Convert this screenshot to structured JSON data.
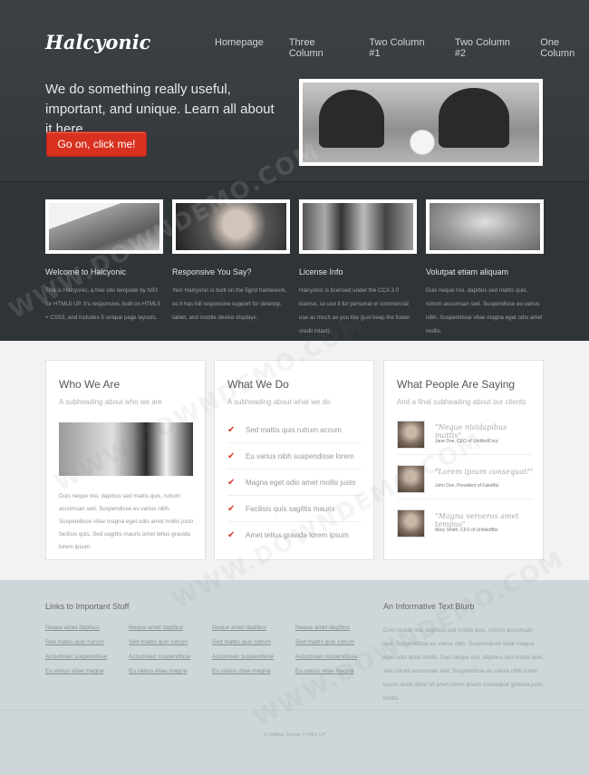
{
  "logo": "Halcyonic",
  "nav": [
    "Homepage",
    "Three Column",
    "Two Column #1",
    "Two Column #2",
    "One Column"
  ],
  "hero": {
    "text": "We do something really useful, important, and unique. Learn all about it here ...",
    "button": "Go on, click me!"
  },
  "features": [
    {
      "title": "Welcome to Halcyonic",
      "text": "This is Halcyonic, a free site template by N33 for HTML5 UP. It's responsive, built on HTML5 + CSS3, and includes 5 unique page layouts."
    },
    {
      "title": "Responsive You Say?",
      "text": "Yes! Halcyonic is built on the 5grid framework, so it has full responsive support for desktop, tablet, and mobile device displays."
    },
    {
      "title": "License Info",
      "text": "Halcyonic is licensed under the CCA 3.0 license, so use it for personal or commercial use as much as you like (just keep the footer credit intact)."
    },
    {
      "title": "Volutpat etiam aliquam",
      "text": "Duis neque nisi, dapibus sed mattis quis, rutrum accumsan sed. Suspendisse eu varius nibh. Suspendisse vitae magna eget odio amet mollis."
    }
  ],
  "who": {
    "title": "Who We Are",
    "subtitle": "A subheading about who we are",
    "text": "Duis neque nisi, dapibus sed mattis quis, rutrum accumsan sed. Suspendisse eu varius nibh. Suspendisse vitae magna eget odio amet mollis justo facilisis quis. Sed sagittis mauris amet tellus gravida lorem ipsum."
  },
  "what": {
    "title": "What We Do",
    "subtitle": "A subheading about what we do",
    "items": [
      "Sed mattis quis rutrum accum",
      "Eu varius nibh suspendisse lorem",
      "Magna eget odio amet mollis justo",
      "Facilisis quis sagittis mauris",
      "Amet tellus gravida lorem ipsum"
    ]
  },
  "testimonials": {
    "title": "What People Are Saying",
    "subtitle": "And a final subheading about our clients",
    "items": [
      {
        "quote": "\"Neque nisidapibus mattis\"",
        "name": "Jane Doe, CEO of UntitledCorp"
      },
      {
        "quote": "\"Lorem ipsum consequat!\"",
        "name": "John Doe, President of FakeBiz"
      },
      {
        "quote": "\"Magna veroeros amet tempus\"",
        "name": "Mary Smith, CFO of UntitledBiz"
      }
    ]
  },
  "footer": {
    "links_title": "Links to Important Stuff",
    "links": [
      [
        "Neque amet dapibus",
        "Neque amet dapibus",
        "Neque amet dapibus",
        "Neque amet dapibus"
      ],
      [
        "Sed mattis quis rutrum",
        "Sed mattis quis rutrum",
        "Sed mattis quis rutrum",
        "Sed mattis quis rutrum"
      ],
      [
        "Accumsan suspendisse",
        "Accumsan suspendisse",
        "Accumsan suspendisse",
        "Accumsan suspendisse"
      ],
      [
        "Eu varius vitae magna",
        "Eu varius vitae magna",
        "Eu varius vitae magna",
        "Eu varius vitae magna"
      ]
    ],
    "blurb_title": "An Informative Text Blurb",
    "blurb": "Duis neque nisi, dapibus sed mattis quis, rutrum accumsan sed. Suspendisse eu varius nibh. Suspendisse vitae magna eget odio amet mollis. Duis neque nisi, dapibus sed mattis quis, sed rutrum accumsan sed. Suspendisse eu varius nibh lorem ipsum amet dolor sit amet lorem ipsum consequat gravida justo mollis.",
    "copyright": "© Untitled. Design: HTML5 UP"
  },
  "watermark": "WWW.DOWNDEMO.COM",
  "colors": {
    "accent": "#d8311f",
    "check": "#d63a2c"
  }
}
